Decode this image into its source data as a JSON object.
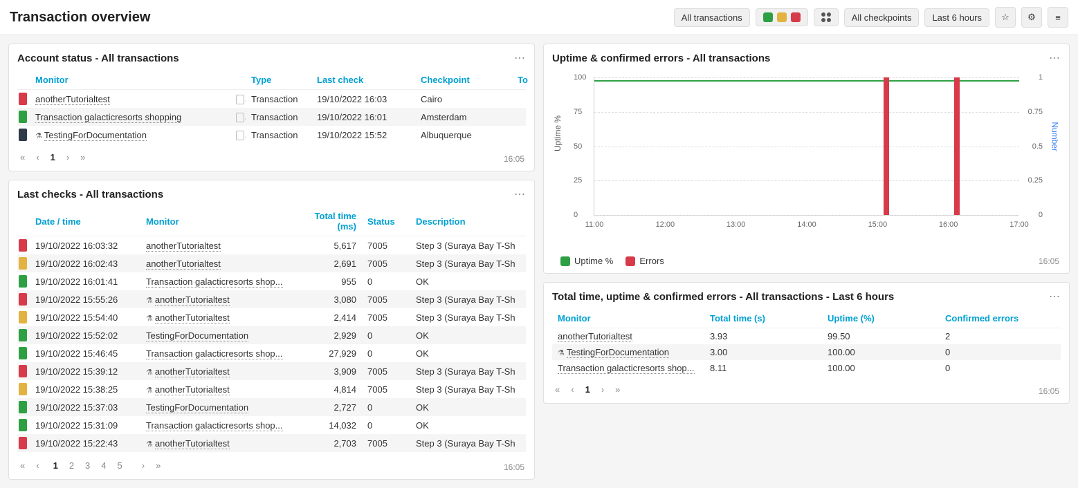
{
  "header": {
    "title": "Transaction overview",
    "filter_transactions": "All transactions",
    "filter_checkpoints": "All checkpoints",
    "filter_time": "Last 6 hours"
  },
  "account_status": {
    "title": "Account status - All transactions",
    "columns": {
      "monitor": "Monitor",
      "type": "Type",
      "last_check": "Last check",
      "checkpoint": "Checkpoint",
      "to": "To"
    },
    "rows": [
      {
        "status": "red",
        "monitor": "anotherTutorialtest",
        "type": "Transaction",
        "last_check": "19/10/2022 16:03",
        "checkpoint": "Cairo"
      },
      {
        "status": "green",
        "monitor": "Transaction galacticresorts shopping",
        "type": "Transaction",
        "last_check": "19/10/2022 16:01",
        "checkpoint": "Amsterdam"
      },
      {
        "status": "dark",
        "monitor": "TestingForDocumentation",
        "flask": true,
        "type": "Transaction",
        "last_check": "19/10/2022 15:52",
        "checkpoint": "Albuquerque"
      }
    ],
    "page": "1",
    "timestamp": "16:05"
  },
  "last_checks": {
    "title": "Last checks - All transactions",
    "columns": {
      "datetime": "Date / time",
      "monitor": "Monitor",
      "total_time": "Total time (ms)",
      "status": "Status",
      "description": "Description"
    },
    "rows": [
      {
        "status": "red",
        "datetime": "19/10/2022 16:03:32",
        "monitor": "anotherTutorialtest",
        "flask": false,
        "total_time": "5,617",
        "code": "7005",
        "description": "Step 3 (Suraya Bay T-Sh"
      },
      {
        "status": "yellow",
        "datetime": "19/10/2022 16:02:43",
        "monitor": "anotherTutorialtest",
        "flask": false,
        "total_time": "2,691",
        "code": "7005",
        "description": "Step 3 (Suraya Bay T-Sh"
      },
      {
        "status": "green",
        "datetime": "19/10/2022 16:01:41",
        "monitor": "Transaction galacticresorts shop...",
        "flask": false,
        "total_time": "955",
        "code": "0",
        "description": "OK"
      },
      {
        "status": "red",
        "datetime": "19/10/2022 15:55:26",
        "monitor": "anotherTutorialtest",
        "flask": true,
        "total_time": "3,080",
        "code": "7005",
        "description": "Step 3 (Suraya Bay T-Sh"
      },
      {
        "status": "yellow",
        "datetime": "19/10/2022 15:54:40",
        "monitor": "anotherTutorialtest",
        "flask": true,
        "total_time": "2,414",
        "code": "7005",
        "description": "Step 3 (Suraya Bay T-Sh"
      },
      {
        "status": "green",
        "datetime": "19/10/2022 15:52:02",
        "monitor": "TestingForDocumentation",
        "flask": false,
        "total_time": "2,929",
        "code": "0",
        "description": "OK"
      },
      {
        "status": "green",
        "datetime": "19/10/2022 15:46:45",
        "monitor": "Transaction galacticresorts shop...",
        "flask": false,
        "total_time": "27,929",
        "code": "0",
        "description": "OK"
      },
      {
        "status": "red",
        "datetime": "19/10/2022 15:39:12",
        "monitor": "anotherTutorialtest",
        "flask": true,
        "total_time": "3,909",
        "code": "7005",
        "description": "Step 3 (Suraya Bay T-Sh"
      },
      {
        "status": "yellow",
        "datetime": "19/10/2022 15:38:25",
        "monitor": "anotherTutorialtest",
        "flask": true,
        "total_time": "4,814",
        "code": "7005",
        "description": "Step 3 (Suraya Bay T-Sh"
      },
      {
        "status": "green",
        "datetime": "19/10/2022 15:37:03",
        "monitor": "TestingForDocumentation",
        "flask": false,
        "total_time": "2,727",
        "code": "0",
        "description": "OK"
      },
      {
        "status": "green",
        "datetime": "19/10/2022 15:31:09",
        "monitor": "Transaction galacticresorts shop...",
        "flask": false,
        "total_time": "14,032",
        "code": "0",
        "description": "OK"
      },
      {
        "status": "red",
        "datetime": "19/10/2022 15:22:43",
        "monitor": "anotherTutorialtest",
        "flask": true,
        "total_time": "2,703",
        "code": "7005",
        "description": "Step 3 (Suraya Bay T-Sh"
      }
    ],
    "pages": [
      "1",
      "2",
      "3",
      "4",
      "5"
    ],
    "timestamp": "16:05"
  },
  "uptime_panel": {
    "title": "Uptime & confirmed errors - All transactions",
    "legend": {
      "uptime": "Uptime %",
      "errors": "Errors"
    },
    "timestamp": "16:05"
  },
  "chart_data": {
    "type": "line+bar",
    "x_ticks": [
      "11:00",
      "12:00",
      "13:00",
      "14:00",
      "15:00",
      "16:00",
      "17:00"
    ],
    "left_axis": {
      "label": "Uptime %",
      "ticks": [
        0,
        25,
        50,
        75,
        100
      ],
      "range": [
        0,
        100
      ]
    },
    "right_axis": {
      "label": "Number",
      "ticks": [
        0,
        0.25,
        0.5,
        0.75,
        1
      ],
      "range": [
        0,
        1
      ]
    },
    "uptime_series": {
      "name": "Uptime %",
      "color": "#2ea043",
      "approx_value": 100
    },
    "error_bars": [
      {
        "time": "15:05",
        "value": 1
      },
      {
        "time": "16:05",
        "value": 1
      }
    ]
  },
  "totals": {
    "title": "Total time, uptime & confirmed errors - All transactions - Last 6 hours",
    "columns": {
      "monitor": "Monitor",
      "total_time": "Total time (s)",
      "uptime": "Uptime (%)",
      "errors": "Confirmed errors"
    },
    "rows": [
      {
        "monitor": "anotherTutorialtest",
        "flask": false,
        "total_time": "3.93",
        "uptime": "99.50",
        "errors": "2"
      },
      {
        "monitor": "TestingForDocumentation",
        "flask": true,
        "total_time": "3.00",
        "uptime": "100.00",
        "errors": "0"
      },
      {
        "monitor": "Transaction galacticresorts shop...",
        "flask": false,
        "total_time": "8.11",
        "uptime": "100.00",
        "errors": "0"
      }
    ],
    "page": "1",
    "timestamp": "16:05"
  }
}
